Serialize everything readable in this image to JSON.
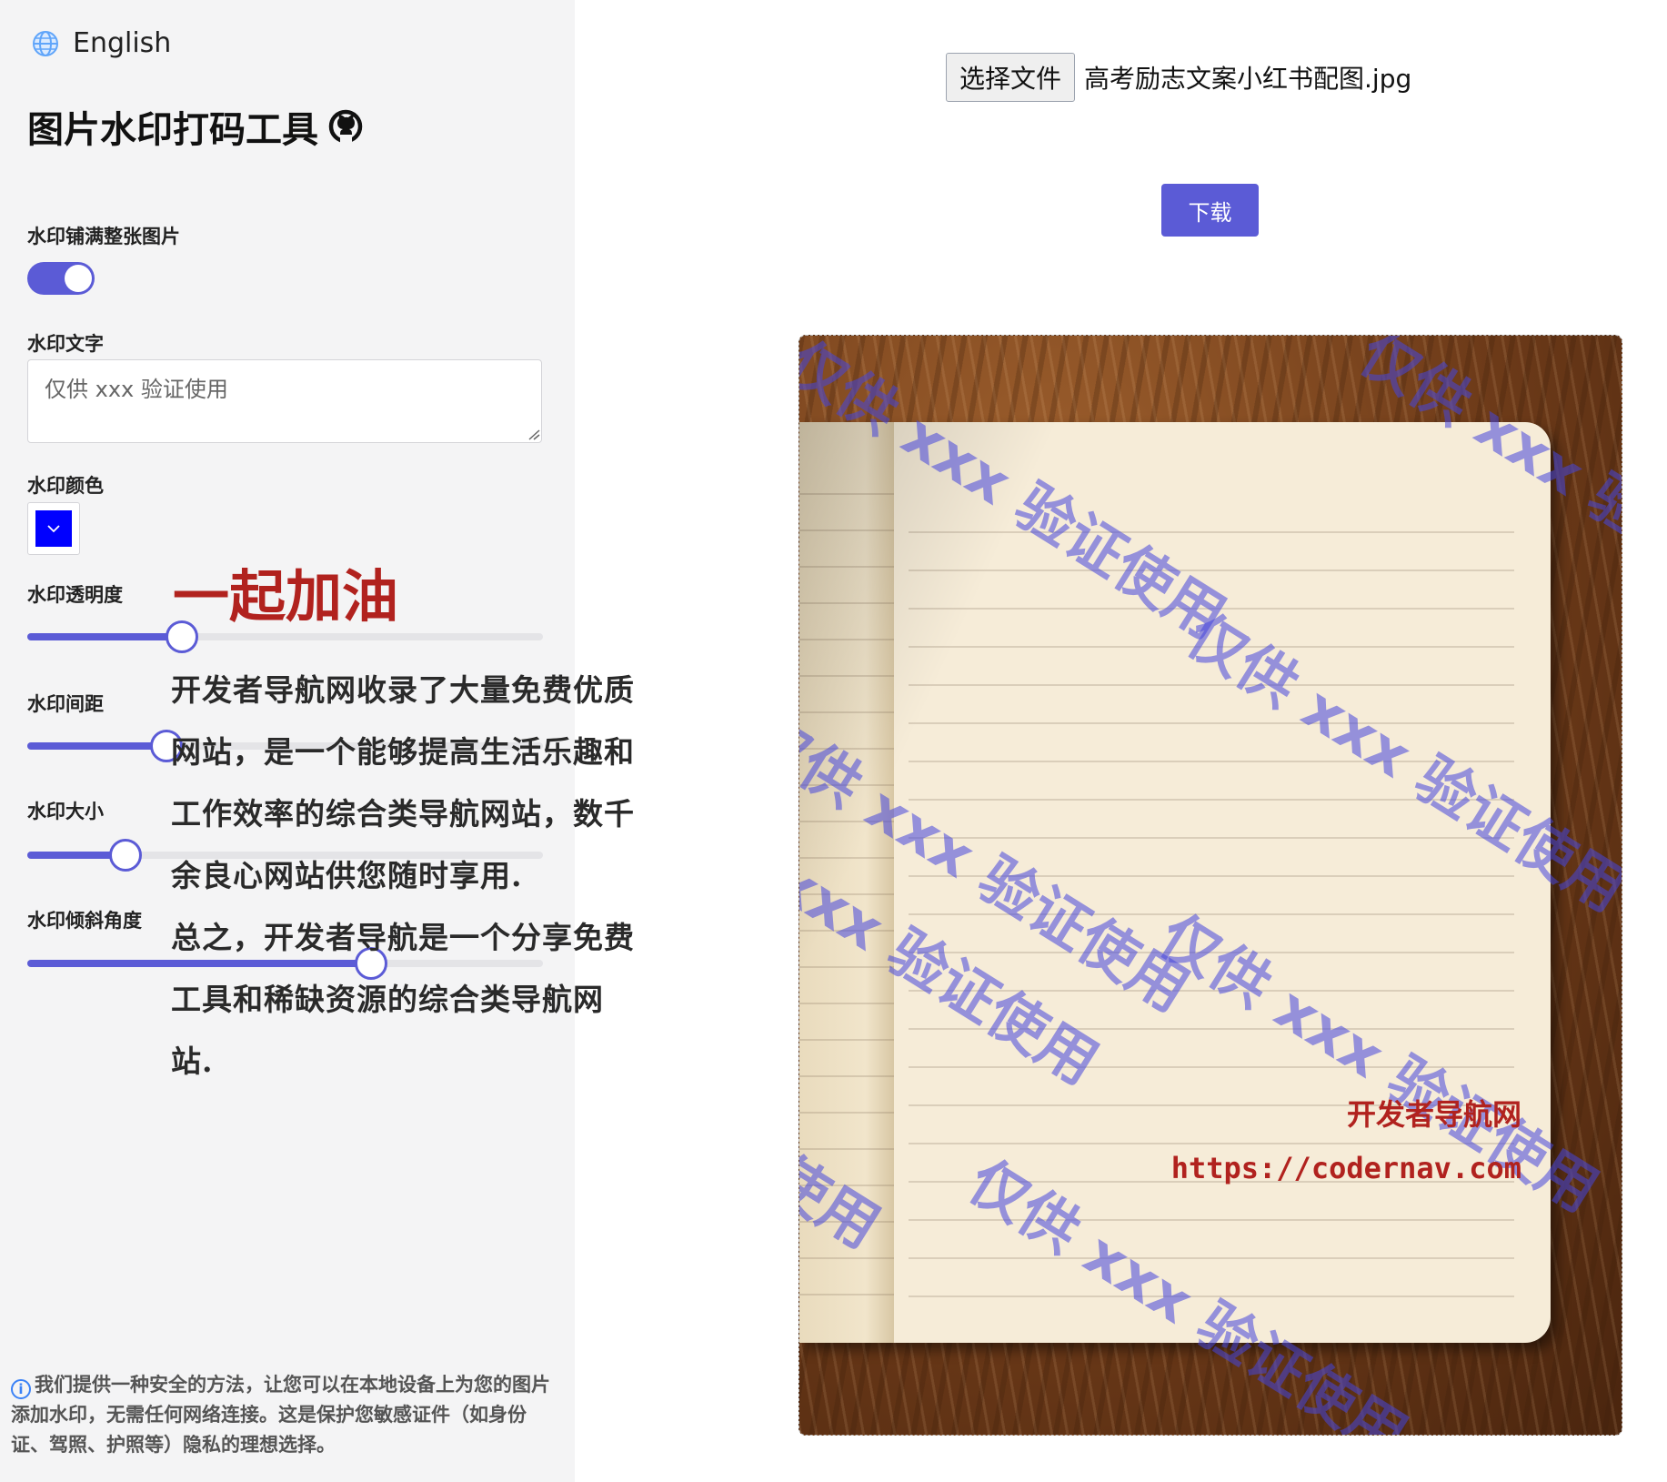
{
  "sidebar": {
    "language_label": "English",
    "title": "图片水印打码工具",
    "controls": {
      "fill_label": "水印铺满整张图片",
      "fill_on": true,
      "text_label": "水印文字",
      "text_placeholder": "仅供 xxx 验证使用",
      "color_label": "水印颜色",
      "color_value": "#0000ff",
      "opacity_label": "水印透明度",
      "opacity_fraction": 0.3,
      "spacing_label": "水印间距",
      "spacing_fraction": 0.27,
      "size_label": "水印大小",
      "size_fraction": 0.19,
      "angle_label": "水印倾斜角度",
      "angle_fraction": 0.667
    },
    "info_text": "我们提供一种安全的方法，让您可以在本地设备上为您的图片添加水印，无需任何网络连接。这是保护您敏感证件（如身份证、驾照、护照等）隐私的理想选择。"
  },
  "main": {
    "choose_file_label": "选择文件",
    "file_name": "高考励志文案小红书配图.jpg",
    "download_label": "下载"
  },
  "preview": {
    "heading": "一起加油",
    "body_lines": [
      "开发者导航网收录了大量免费优质",
      "网站，是一个能够提高生活乐趣和",
      "工作效率的综合类导航网站，数千",
      "余良心网站供您随时享用.",
      "总之，开发者导航是一个分享免费",
      "工具和稀缺资源的综合类导航网",
      "站."
    ],
    "signature": "开发者导航网",
    "url": "https://codernav.com",
    "watermark_text": "仅供 xxx 验证使用"
  },
  "colors": {
    "accent": "#5b5bd6",
    "watermark": "#4646dc"
  },
  "icons": {
    "language": "globe-icon",
    "github": "github-icon",
    "info": "info-icon",
    "dropdown": "chevron-down-icon"
  }
}
